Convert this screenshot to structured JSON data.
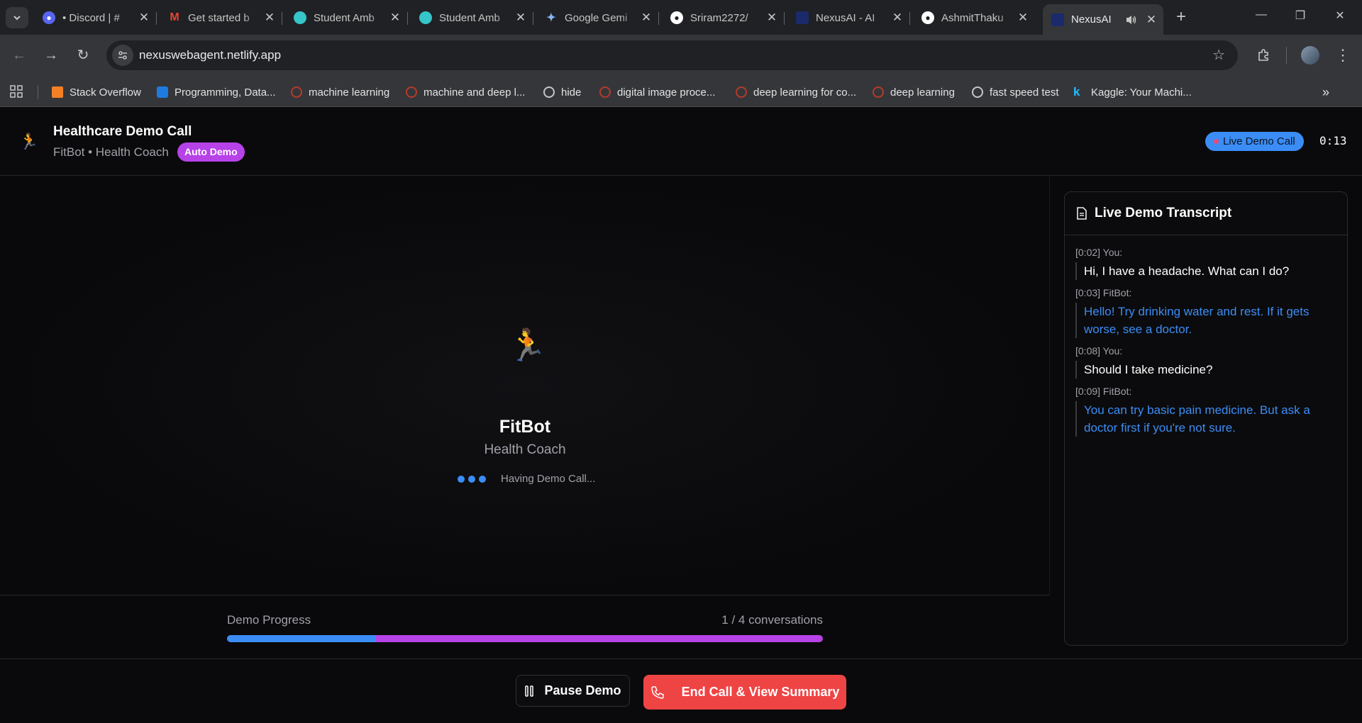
{
  "browser": {
    "tabs": [
      {
        "title": "• Discord | #",
        "favicon": "discord-icon",
        "color": "#5865f2"
      },
      {
        "title": "Get started b",
        "favicon": "gmail-icon",
        "color": "#ea4335"
      },
      {
        "title": "Student Amb",
        "favicon": "student-ambassador-icon",
        "color": "#36c5c9"
      },
      {
        "title": "Student Amb",
        "favicon": "student-ambassador-icon",
        "color": "#36c5c9"
      },
      {
        "title": "Google Gemi",
        "favicon": "gemini-icon",
        "color": "#8ab4f8"
      },
      {
        "title": "Sriram2272/",
        "favicon": "github-icon",
        "color": "#ffffff"
      },
      {
        "title": "NexusAI - AI",
        "favicon": "nexusai-icon",
        "color": "#1b2a6b"
      },
      {
        "title": "AshmitThaku",
        "favicon": "github-icon",
        "color": "#ffffff"
      },
      {
        "title": "NexusAI",
        "favicon": "nexusai-icon",
        "color": "#1b2a6b",
        "active": true
      }
    ],
    "url": "nexuswebagent.netlify.app",
    "bookmarks": [
      {
        "label": "Stack Overflow",
        "icon": "stackoverflow-icon",
        "color": "#f48024"
      },
      {
        "label": "Programming, Data...",
        "icon": "programming-icon",
        "color": "#1f7ae0"
      },
      {
        "label": "machine learning",
        "icon": "ml-icon",
        "color": "#b53a2a"
      },
      {
        "label": "machine and deep l...",
        "icon": "ml-icon",
        "color": "#b53a2a"
      },
      {
        "label": "hide",
        "icon": "globe-icon",
        "color": "#c4c7c5"
      },
      {
        "label": "digital image proce...",
        "icon": "ml-icon",
        "color": "#b53a2a"
      },
      {
        "label": "deep learning for co...",
        "icon": "ml-icon",
        "color": "#b53a2a"
      },
      {
        "label": "deep learning",
        "icon": "ml-icon",
        "color": "#b53a2a"
      },
      {
        "label": "fast speed test",
        "icon": "globe-icon",
        "color": "#c4c7c5"
      },
      {
        "label": "Kaggle: Your Machi...",
        "icon": "kaggle-icon",
        "color": "#20beff"
      }
    ]
  },
  "header": {
    "emoji": "🏃",
    "title": "Healthcare Demo Call",
    "subtitle": "FitBot • Health Coach",
    "badge": "Auto Demo",
    "live_label": "Live Demo Call",
    "timer": "0:13"
  },
  "stage": {
    "emoji": "🏃",
    "bot_name": "FitBot",
    "bot_role": "Health Coach",
    "status": "Having Demo Call..."
  },
  "progress": {
    "label": "Demo Progress",
    "count": "1 / 4 conversations",
    "fraction": 0.25
  },
  "transcript": {
    "title": "Live Demo Transcript",
    "messages": [
      {
        "meta": "[0:02] You:",
        "text": "Hi, I have a headache. What can I do?",
        "speaker": "user"
      },
      {
        "meta": "[0:03] FitBot:",
        "text": "Hello! Try drinking water and rest. If it gets worse, see a doctor.",
        "speaker": "bot"
      },
      {
        "meta": "[0:08] You:",
        "text": "Should I take medicine?",
        "speaker": "user"
      },
      {
        "meta": "[0:09] FitBot:",
        "text": "You can try basic pain medicine. But ask a doctor first if you're not sure.",
        "speaker": "bot"
      }
    ]
  },
  "footer": {
    "pause_label": "Pause Demo",
    "end_label": "End Call & View Summary"
  },
  "colors": {
    "accent_blue": "#3b8df5",
    "accent_purple": "#b642e8",
    "danger": "#ef4444"
  }
}
